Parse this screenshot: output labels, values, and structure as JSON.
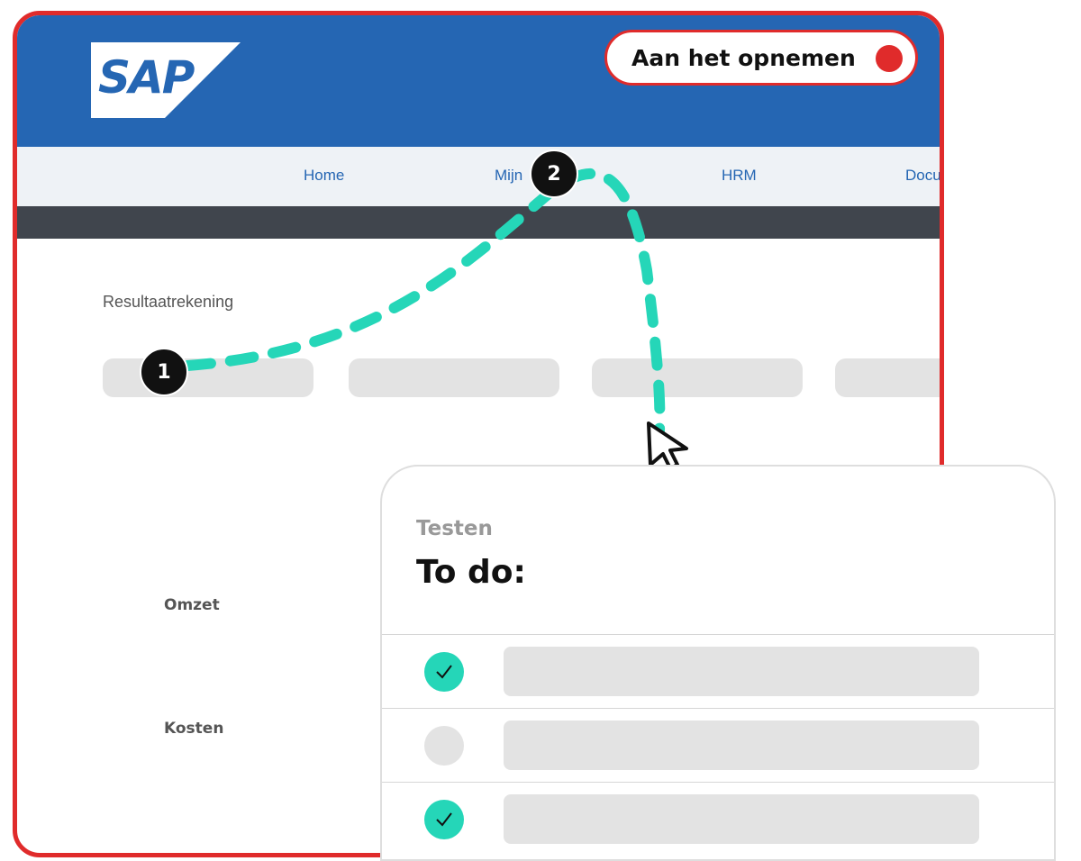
{
  "recording": {
    "label": "Aan het opnemen",
    "dot_color": "#e02b2b"
  },
  "logo": {
    "text": "SAP"
  },
  "nav": {
    "items": [
      "Home",
      "Mijn",
      "HRM",
      "Docu"
    ]
  },
  "report": {
    "title": "Resultaatrekening",
    "rows": [
      "Omzet",
      "Kosten"
    ]
  },
  "steps": [
    "1",
    "2"
  ],
  "panel": {
    "subtitle": "Testen",
    "title": "To do:",
    "items": [
      {
        "done": true
      },
      {
        "done": false
      },
      {
        "done": true
      }
    ]
  },
  "colors": {
    "brand": "#2566b3",
    "accent": "#25d6b8",
    "frame": "#e02b2b",
    "nav_bg": "#eef2f6",
    "dark_bar": "#40454d"
  },
  "icons": [
    "sap-logo",
    "record-dot-icon",
    "cursor-arrow-icon",
    "checkmark-icon"
  ]
}
